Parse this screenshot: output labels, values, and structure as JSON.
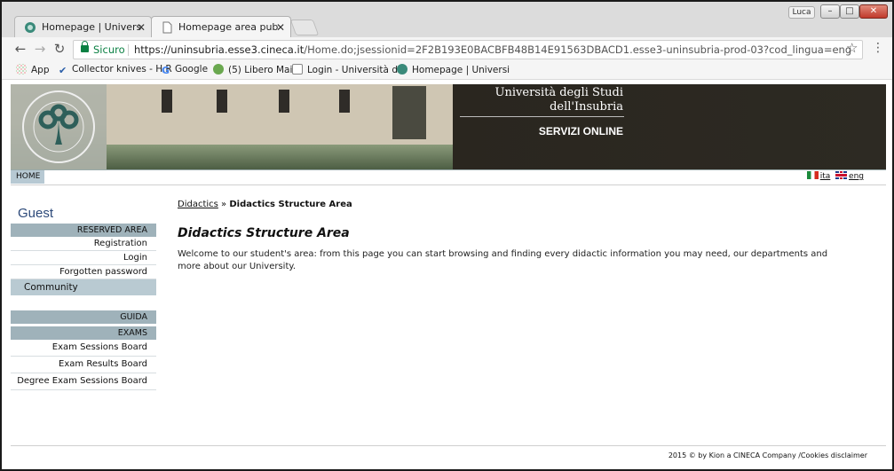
{
  "browser": {
    "tabs": [
      {
        "label": "Homepage | Università di",
        "active": false
      },
      {
        "label": "Homepage area pubblica",
        "active": true
      }
    ],
    "user_badge": "Luca",
    "window_buttons": {
      "minimize": "–",
      "maximize": "□",
      "close": "✕"
    },
    "nav": {
      "back": "←",
      "forward": "→",
      "reload": "↻"
    },
    "address": {
      "secure_label": "Sicuro",
      "url_host": "https://uninsubria.esse3.cineca.it",
      "url_rest": "/Home.do;jsessionid=2F2B193E0BACBFB48B14E91563DBACD1.esse3-uninsubria-prod-03?cod_lingua=eng"
    },
    "bookmarks": [
      {
        "label": "App",
        "icon": "apps-grid-icon"
      },
      {
        "label": "Collector knives - H.R",
        "icon": "checkmark-icon"
      },
      {
        "label": "Google",
        "icon": "google-icon"
      },
      {
        "label": "(5) Libero Mail",
        "icon": "libero-icon"
      },
      {
        "label": "Login - Università de",
        "icon": "page-icon"
      },
      {
        "label": "Homepage | Universi",
        "icon": "globe-icon"
      }
    ]
  },
  "header": {
    "university_line1": "Università degli Studi",
    "university_line2": "dell'Insubria",
    "services": "SERVIZI ONLINE",
    "home": "HOME",
    "lang_it": "ita",
    "lang_en": "eng"
  },
  "sidebar": {
    "guest": "Guest",
    "reserved_area": "RESERVED AREA",
    "reserved_items": [
      "Registration",
      "Login",
      "Forgotten password"
    ],
    "community": "Community",
    "guida": "GUIDA",
    "exams": "EXAMS",
    "exam_items": [
      "Exam Sessions Board",
      "Exam Results Board",
      "Degree Exam Sessions Board"
    ]
  },
  "main": {
    "breadcrumb_link": "Didactics",
    "breadcrumb_sep": "»",
    "breadcrumb_current": "Didactics Structure Area",
    "title": "Didactics Structure Area",
    "intro": "Welcome to our student's area: from this page you can start browsing and finding every didactic information you may need, our departments and more about our University."
  },
  "footer": {
    "text": "2015 © by Kion a CINECA Company /Cookies disclaimer"
  },
  "colors": {
    "sidebar_header": "#9fb2ba",
    "community_bg": "#b9cad2",
    "guest_text": "#2d4a7a",
    "banner_dark": "#2a261f",
    "secure_green": "#0b8043"
  }
}
